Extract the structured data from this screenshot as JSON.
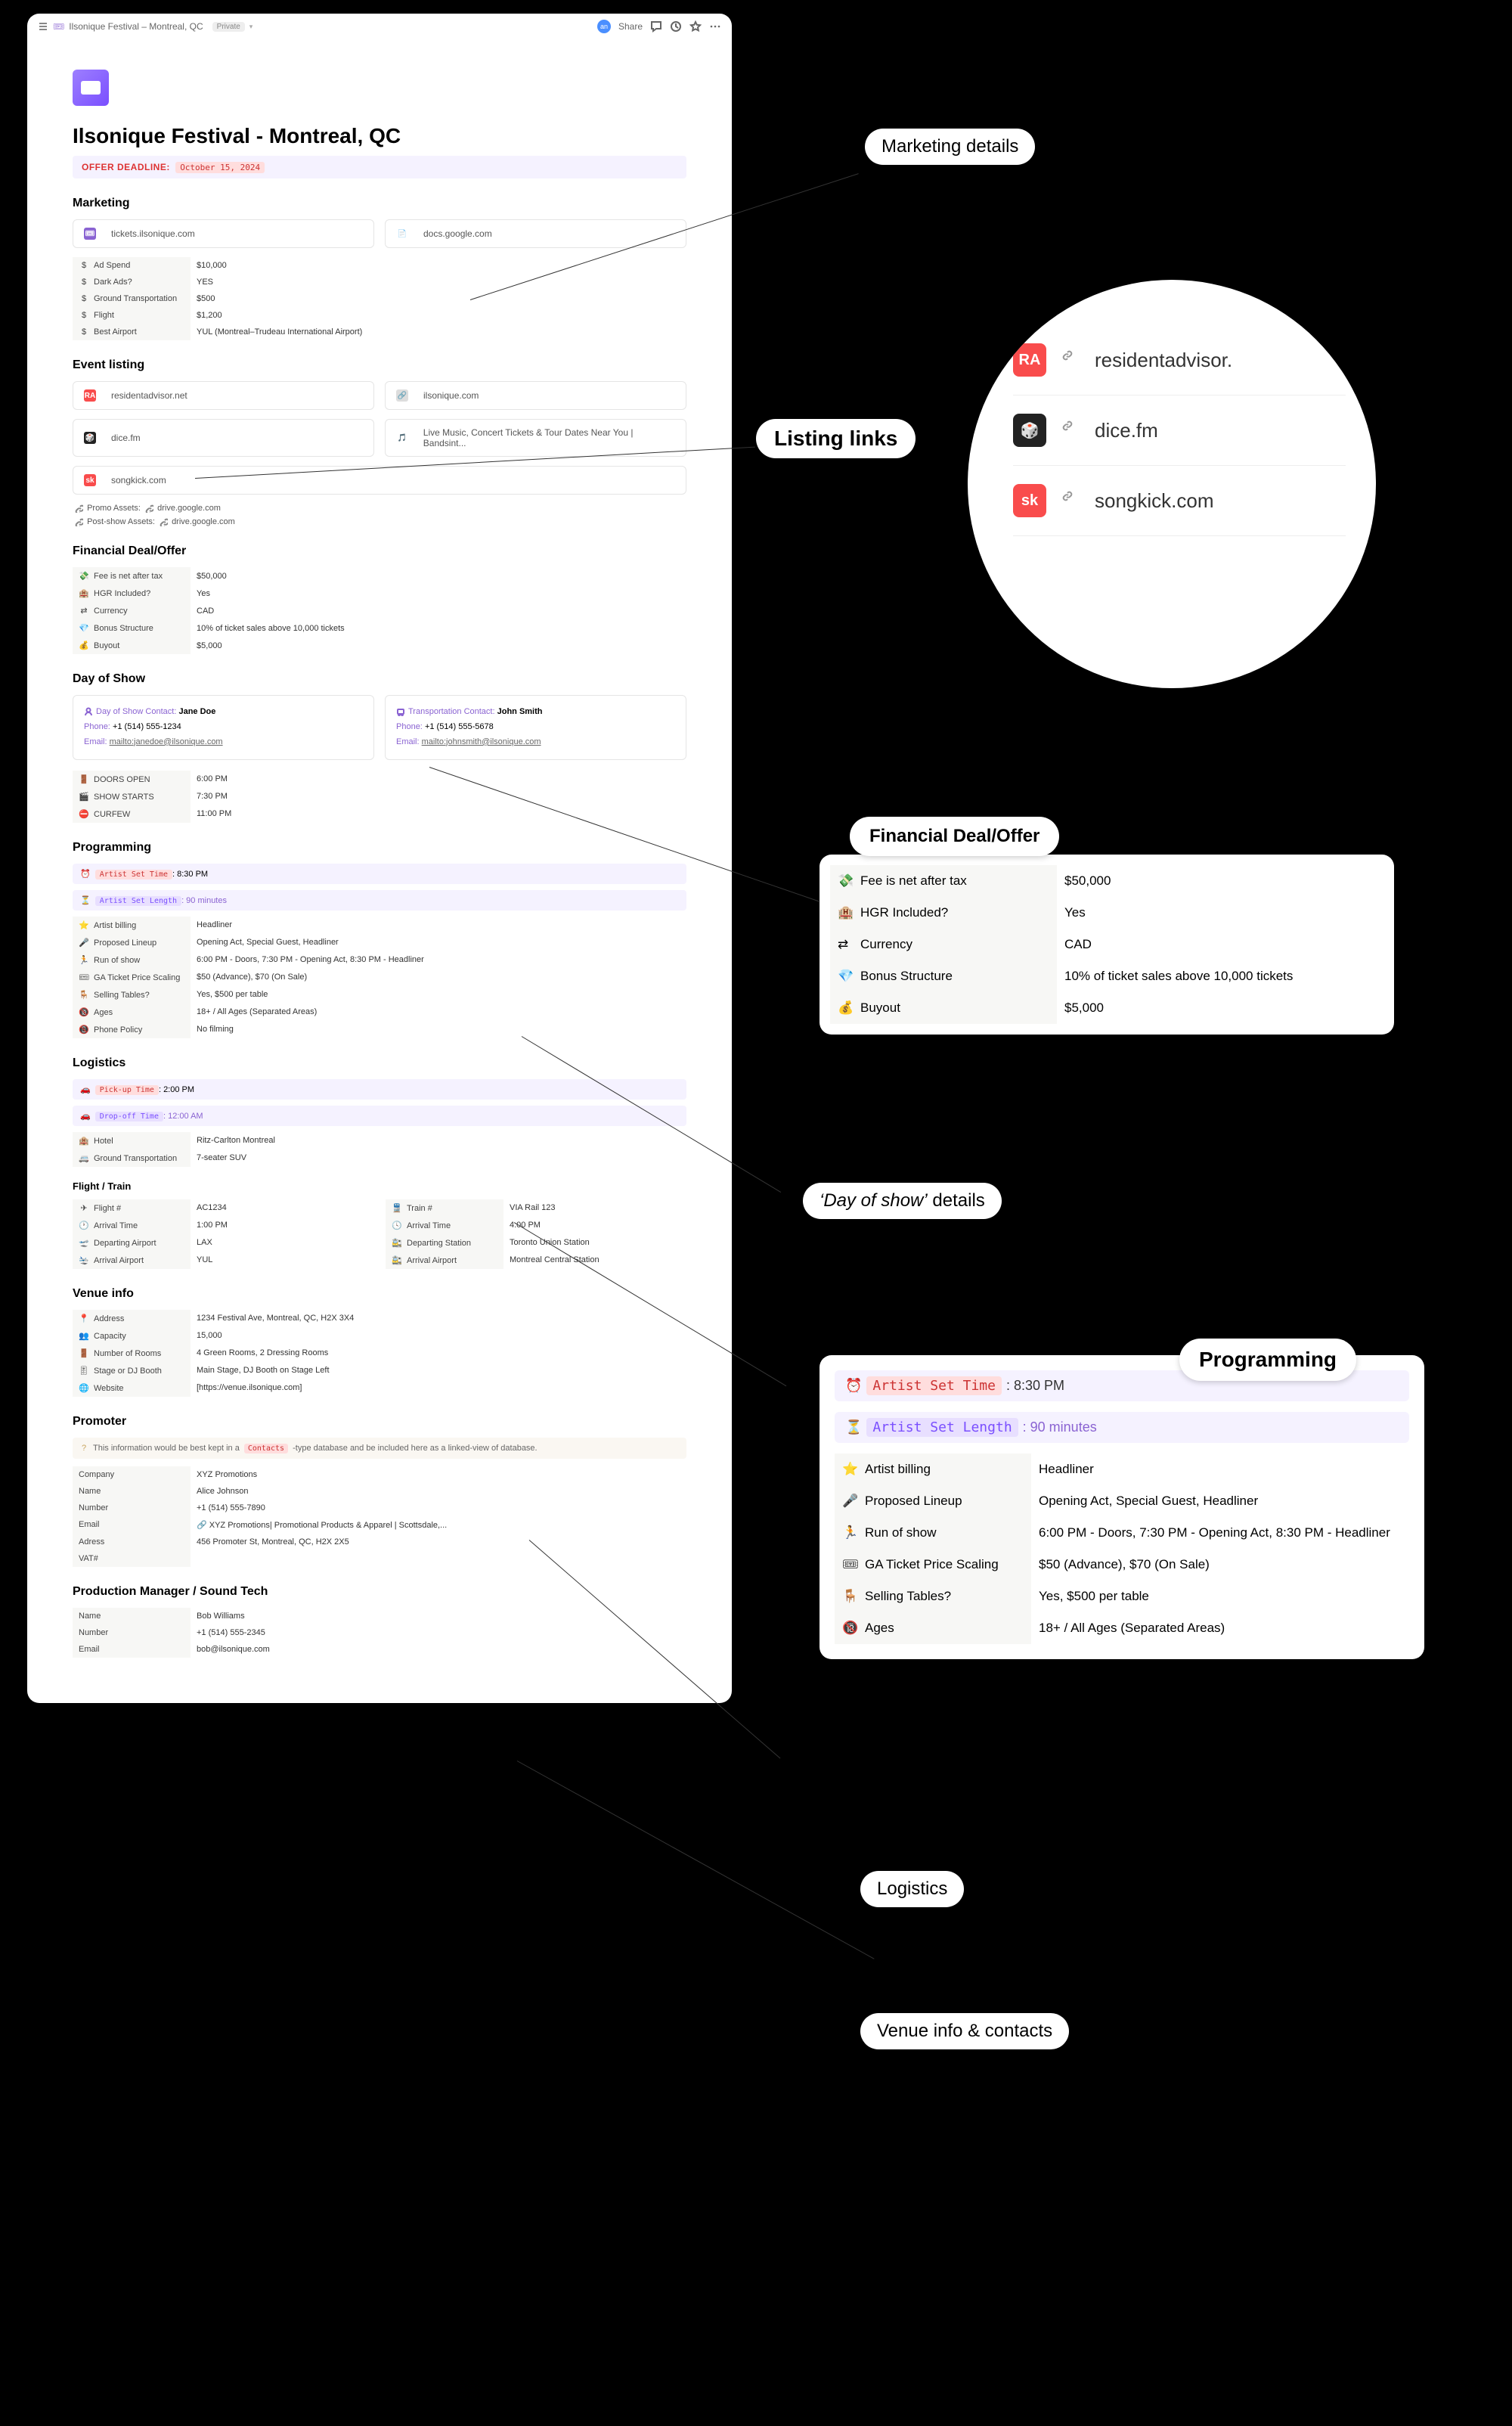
{
  "topbar": {
    "breadcrumb": "Ilsonique Festival – Montreal, QC",
    "private": "Private",
    "share": "Share"
  },
  "page": {
    "title": "Ilsonique Festival - Montreal, QC",
    "offer_label": "OFFER DEADLINE:",
    "offer_date": "October 15, 2024"
  },
  "marketing": {
    "heading": "Marketing",
    "bookmarks": [
      {
        "icon_bg": "#8a63d2",
        "icon_txt": "🎟",
        "text": "tickets.ilsonique.com"
      },
      {
        "icon_bg": "#fff",
        "icon_txt": "📄",
        "text": "docs.google.com"
      }
    ],
    "rows": [
      {
        "icon": "$",
        "k": "Ad Spend",
        "v": "$10,000"
      },
      {
        "icon": "$",
        "k": "Dark Ads?",
        "v": "YES"
      },
      {
        "icon": "$",
        "k": "Ground Transportation",
        "v": "$500"
      },
      {
        "icon": "$",
        "k": "Flight",
        "v": "$1,200"
      },
      {
        "icon": "$",
        "k": "Best Airport",
        "v": "YUL (Montreal–Trudeau International Airport)"
      }
    ]
  },
  "listing": {
    "heading": "Event listing",
    "rows": [
      [
        {
          "bg": "#f94c4c",
          "txt": "RA",
          "label": "residentadvisor.net"
        },
        {
          "bg": "#ddd",
          "txt": "🔗",
          "label": "ilsonique.com"
        }
      ],
      [
        {
          "bg": "#222",
          "txt": "🎲",
          "label": "dice.fm"
        },
        {
          "bg": "#fff",
          "txt": "🎵",
          "label": "Live Music, Concert Tickets & Tour Dates Near You | Bandsint..."
        }
      ],
      [
        {
          "bg": "#f94c4c",
          "txt": "sk",
          "label": "songkick.com"
        }
      ]
    ],
    "promo": "Promo Assets:",
    "promo_link": "drive.google.com",
    "postshow": "Post-show Assets:",
    "postshow_link": "drive.google.com"
  },
  "financial": {
    "heading": "Financial Deal/Offer",
    "rows": [
      {
        "icon": "💸",
        "k": "Fee is net after tax",
        "v": "$50,000"
      },
      {
        "icon": "🏨",
        "k": "HGR Included?",
        "v": "Yes"
      },
      {
        "icon": "⇄",
        "k": "Currency",
        "v": "CAD"
      },
      {
        "icon": "💎",
        "k": "Bonus Structure",
        "v": "10% of ticket sales above 10,000 tickets"
      },
      {
        "icon": "💰",
        "k": "Buyout",
        "v": "$5,000"
      }
    ]
  },
  "dayofshow": {
    "heading": "Day of Show",
    "contact1": {
      "title": "Day of Show Contact:",
      "name": "Jane Doe",
      "phone_l": "Phone:",
      "phone": "+1 (514) 555-1234",
      "email_l": "Email:",
      "email": "mailto:janedoe@ilsonique.com"
    },
    "contact2": {
      "title": "Transportation Contact:",
      "name": "John Smith",
      "phone_l": "Phone:",
      "phone": "+1 (514) 555-5678",
      "email_l": "Email:",
      "email": "mailto:johnsmith@ilsonique.com"
    },
    "times": [
      {
        "icon": "🚪",
        "k": "DOORS OPEN",
        "v": "6:00 PM"
      },
      {
        "icon": "🎬",
        "k": "SHOW STARTS",
        "v": "7:30 PM"
      },
      {
        "icon": "⛔",
        "k": "CURFEW",
        "v": "11:00 PM"
      }
    ]
  },
  "programming": {
    "heading": "Programming",
    "set_time_k": "Artist Set Time",
    "set_time_v": ": 8:30 PM",
    "set_len_k": "Artist Set Length",
    "set_len_v": ": 90 minutes",
    "rows": [
      {
        "icon": "⭐",
        "k": "Artist billing",
        "v": "Headliner"
      },
      {
        "icon": "🎤",
        "k": "Proposed Lineup",
        "v": "Opening Act, Special Guest, Headliner"
      },
      {
        "icon": "🏃",
        "k": "Run of show",
        "v": "6:00 PM - Doors, 7:30 PM - Opening Act, 8:30 PM - Headliner"
      },
      {
        "icon": "🎟",
        "k": "GA Ticket Price Scaling",
        "v": "$50 (Advance), $70 (On Sale)"
      },
      {
        "icon": "🪑",
        "k": "Selling Tables?",
        "v": "Yes, $500 per table"
      },
      {
        "icon": "🔞",
        "k": "Ages",
        "v": "18+ / All Ages (Separated Areas)"
      },
      {
        "icon": "📵",
        "k": "Phone Policy",
        "v": "No filming"
      }
    ]
  },
  "logistics": {
    "heading": "Logistics",
    "pickup_k": "Pick-up Time",
    "pickup_v": ": 2:00 PM",
    "dropoff_k": "Drop-off Time",
    "dropoff_v": ": 12:00 AM",
    "rows": [
      {
        "icon": "🏨",
        "k": "Hotel",
        "v": "Ritz-Carlton Montreal"
      },
      {
        "icon": "🚐",
        "k": "Ground Transportation",
        "v": "7-seater SUV"
      }
    ],
    "flight_heading": "Flight / Train",
    "flight": [
      {
        "icon": "✈",
        "k": "Flight #",
        "v": "AC1234"
      },
      {
        "icon": "🕐",
        "k": "Arrival Time",
        "v": "1:00 PM"
      },
      {
        "icon": "🛫",
        "k": "Departing Airport",
        "v": "LAX"
      },
      {
        "icon": "🛬",
        "k": "Arrival Airport",
        "v": "YUL"
      }
    ],
    "train": [
      {
        "icon": "🚆",
        "k": "Train #",
        "v": "VIA Rail 123"
      },
      {
        "icon": "🕓",
        "k": "Arrival Time",
        "v": "4:00 PM"
      },
      {
        "icon": "🚉",
        "k": "Departing Station",
        "v": "Toronto Union Station"
      },
      {
        "icon": "🚉",
        "k": "Arrival Airport",
        "v": "Montreal Central Station"
      }
    ]
  },
  "venue": {
    "heading": "Venue info",
    "rows": [
      {
        "icon": "📍",
        "k": "Address",
        "v": "1234 Festival Ave, Montreal, QC, H2X 3X4"
      },
      {
        "icon": "👥",
        "k": "Capacity",
        "v": "15,000"
      },
      {
        "icon": "🚪",
        "k": "Number of Rooms",
        "v": "4 Green Rooms, 2 Dressing Rooms"
      },
      {
        "icon": "🎚",
        "k": "Stage or DJ Booth",
        "v": "Main Stage, DJ Booth on Stage Left"
      },
      {
        "icon": "🌐",
        "k": "Website",
        "v": "[https://venue.ilsonique.com]"
      }
    ]
  },
  "promoter": {
    "heading": "Promoter",
    "note_pre": "This information would be best kept in a",
    "note_tag": "Contacts",
    "note_post": "-type database and be included here as a linked-view of database.",
    "rows": [
      {
        "k": "Company",
        "v": "XYZ Promotions"
      },
      {
        "k": "Name",
        "v": "Alice Johnson"
      },
      {
        "k": "Number",
        "v": "+1 (514) 555-7890"
      },
      {
        "k": "Email",
        "v": "🔗 XYZ Promotions| Promotional Products & Apparel | Scottsdale,..."
      },
      {
        "k": "Adress",
        "v": "456 Promoter St, Montreal, QC, H2X 2X5"
      },
      {
        "k": "VAT#",
        "v": ""
      }
    ]
  },
  "prodmgr": {
    "heading": "Production Manager / Sound Tech",
    "rows": [
      {
        "k": "Name",
        "v": "Bob Williams"
      },
      {
        "k": "Number",
        "v": "+1 (514) 555-2345"
      },
      {
        "k": "Email",
        "v": "bob@ilsonique.com"
      }
    ]
  },
  "annotations": {
    "marketing": "Marketing details",
    "listing": "Listing links",
    "financial": "Financial Deal/Offer",
    "dayofshow": "‘Day of show’ details",
    "programming": "Programming",
    "logistics": "Logistics",
    "venue": "Venue info & contacts"
  },
  "zoom_listing": [
    {
      "bg": "#f94c4c",
      "txt": "RA",
      "label": "residentadvisor."
    },
    {
      "bg": "#222",
      "txt": "🎲",
      "label": "dice.fm"
    },
    {
      "bg": "#f94c4c",
      "txt": "sk",
      "label": "songkick.com"
    }
  ]
}
